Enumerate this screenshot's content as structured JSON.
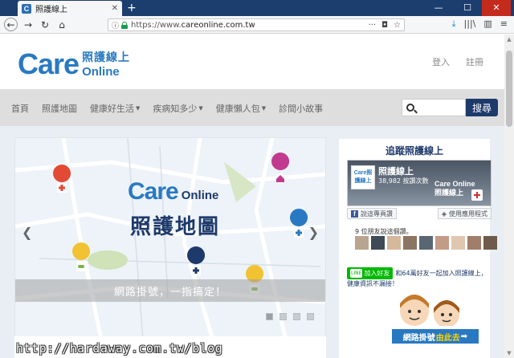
{
  "browser": {
    "tab_favicon": "C",
    "tab_title": "照護線上",
    "tab_close": "✕",
    "new_tab": "+",
    "win_min": "—",
    "win_max": "☐",
    "win_close": "✕",
    "url_prefix": "https://www.",
    "url_domain": "careonline.com.tw",
    "url_menu": "···",
    "pocket": "◘",
    "bookmark": "☆",
    "download": "⤓",
    "library": "|||\\",
    "sidebar_toggle": "▥",
    "menu": "≡"
  },
  "header": {
    "logo_care": "Care",
    "logo_zh": "照護線上",
    "logo_online": "Online",
    "login": "登入",
    "register": "註冊"
  },
  "menu": {
    "items": [
      "首頁",
      "照護地圖",
      "健康好生活",
      "疾病知多少",
      "健康懶人包",
      "診間小故事"
    ],
    "caret": "▼",
    "search_button": "搜尋"
  },
  "carousel": {
    "brand_care": "Care",
    "brand_online": "Online",
    "title": "照護地圖",
    "caption": "網路掛號，一指搞定！",
    "prev": "❮",
    "next": "❯",
    "slides": 4,
    "active_slide": 1
  },
  "sidebar": {
    "title": "追蹤照護線上",
    "fb_avatar_text": "Care照護線上",
    "fb_page_name": "照護線上",
    "fb_likes": "38,982 按讚次數",
    "fb_cover_brand": "Care Online",
    "fb_cover_zh": "照護線上",
    "fb_like_button": "說這專頁讚",
    "fb_share_button": "使用應用程式",
    "fb_like_icon": "f",
    "fb_share_icon": "◈",
    "friends_text": "9 位朋友說這個讚。",
    "line_button": "加入好友",
    "line_badge": "LINE",
    "line_text": "和64萬好友一起加入照護線上，健康資訊不漏接！",
    "promo_text": "網路掛號",
    "promo_highlight": "由此去",
    "promo_arrow": "➡"
  },
  "watermark": "http://hardaway.com.tw/blog",
  "colors": {
    "brand_blue": "#2979c2",
    "navy": "#1e3a6b",
    "line_green": "#00b900",
    "titlebar": "#1c3e6e"
  }
}
